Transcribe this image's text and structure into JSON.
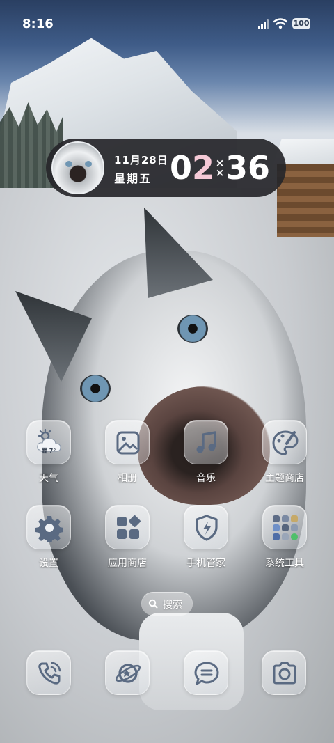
{
  "status_bar": {
    "time": "8:16",
    "battery": "100",
    "icons": [
      "cellular-signal-icon",
      "wifi-icon",
      "battery-icon"
    ]
  },
  "widget": {
    "date": "11月28日",
    "weekday": "星期五",
    "clock": {
      "h1": "0",
      "h2": "2",
      "m1": "3",
      "m2": "6",
      "separator_top": "×",
      "separator_bottom": "×"
    }
  },
  "apps": [
    {
      "label": "天气",
      "icon": "weather-icon",
      "weather_text": "霾 7°"
    },
    {
      "label": "相册",
      "icon": "gallery-icon"
    },
    {
      "label": "音乐",
      "icon": "music-icon"
    },
    {
      "label": "主题商店",
      "icon": "theme-store-icon"
    },
    {
      "label": "设置",
      "icon": "settings-gear-icon"
    },
    {
      "label": "应用商店",
      "icon": "app-store-icon"
    },
    {
      "label": "手机管家",
      "icon": "security-shield-icon"
    },
    {
      "label": "系统工具",
      "icon": "system-tools-folder-icon"
    }
  ],
  "search": {
    "label": "搜索"
  },
  "dock": [
    {
      "icon": "phone-icon"
    },
    {
      "icon": "browser-planet-icon"
    },
    {
      "icon": "messages-icon"
    },
    {
      "icon": "camera-icon"
    }
  ],
  "colors": {
    "icon_glyph": "#5a6a82",
    "accent_pink": "#f5c9d6",
    "widget_bg": "#26262a"
  }
}
